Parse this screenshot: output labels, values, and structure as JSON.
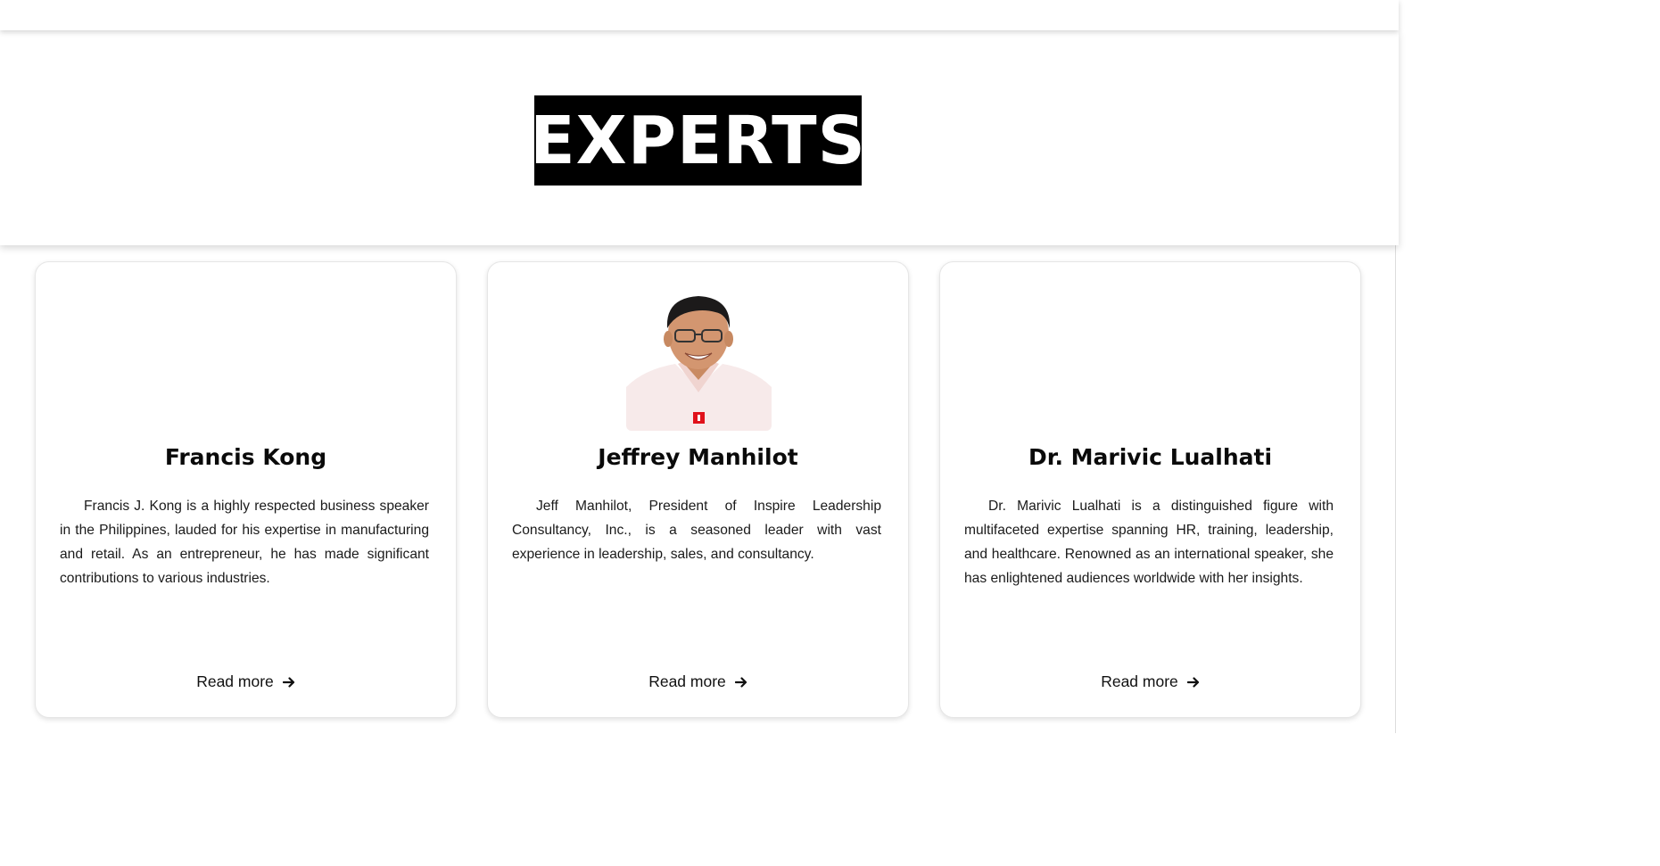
{
  "hero": {
    "title": "EXPERTS"
  },
  "experts": [
    {
      "name": "Francis Kong",
      "bio": "Francis J. Kong is a highly respected business speaker in the Philippines, lauded for his expertise in manufacturing and retail. As an entrepreneur, he has made significant contributions to various industries.",
      "read_more": "Read more",
      "has_photo": false
    },
    {
      "name": "Jeffrey Manhilot",
      "bio": "Jeff Manhilot, President of Inspire Leadership Consultancy, Inc., is a seasoned leader with vast experience in leadership, sales, and consultancy.",
      "read_more": "Read more",
      "has_photo": true
    },
    {
      "name": "Dr. Marivic Lualhati",
      "bio": "Dr. Marivic Lualhati is a distinguished figure with multifaceted expertise spanning HR, training, leadership, and healthcare. Renowned as an international speaker, she has enlightened audiences worldwide with her insights.",
      "read_more": "Read more",
      "has_photo": false
    }
  ],
  "icons": {
    "read_more": "arrow-right-icon",
    "photo": "expert-portrait"
  },
  "colors": {
    "title_bg": "#000000",
    "title_text": "#ffffff",
    "card_border": "#e6e6e6",
    "badge": "#e0121b"
  }
}
